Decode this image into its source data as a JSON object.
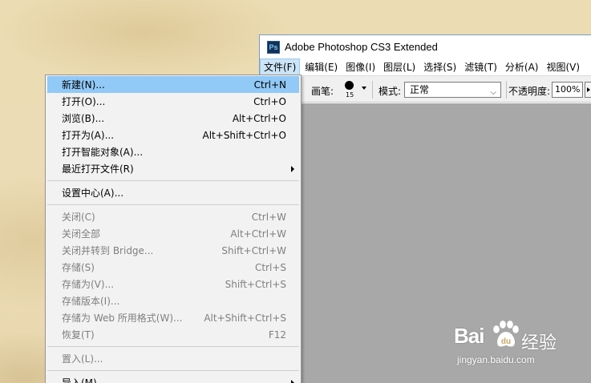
{
  "window": {
    "logo_text": "Ps",
    "title": "Adobe Photoshop CS3 Extended"
  },
  "menubar": {
    "items": [
      {
        "label": "文件(F)"
      },
      {
        "label": "编辑(E)"
      },
      {
        "label": "图像(I)"
      },
      {
        "label": "图层(L)"
      },
      {
        "label": "选择(S)"
      },
      {
        "label": "滤镜(T)"
      },
      {
        "label": "分析(A)"
      },
      {
        "label": "视图(V)"
      }
    ]
  },
  "options_bar": {
    "brush_label": "画笔:",
    "brush_size": "15",
    "mode_label": "模式:",
    "mode_value": "正常",
    "opacity_label": "不透明度:",
    "opacity_value": "100%"
  },
  "file_menu": {
    "items": [
      {
        "label": "新建(N)...",
        "shortcut": "Ctrl+N"
      },
      {
        "label": "打开(O)...",
        "shortcut": "Ctrl+O"
      },
      {
        "label": "浏览(B)...",
        "shortcut": "Alt+Ctrl+O"
      },
      {
        "label": "打开为(A)...",
        "shortcut": "Alt+Shift+Ctrl+O"
      },
      {
        "label": "打开智能对象(A)...",
        "shortcut": ""
      },
      {
        "label": "最近打开文件(R)",
        "shortcut": ""
      },
      {
        "label": "设置中心(A)...",
        "shortcut": ""
      },
      {
        "label": "关闭(C)",
        "shortcut": "Ctrl+W"
      },
      {
        "label": "关闭全部",
        "shortcut": "Alt+Ctrl+W"
      },
      {
        "label": "关闭并转到 Bridge...",
        "shortcut": "Shift+Ctrl+W"
      },
      {
        "label": "存储(S)",
        "shortcut": "Ctrl+S"
      },
      {
        "label": "存储为(V)...",
        "shortcut": "Shift+Ctrl+S"
      },
      {
        "label": "存储版本(I)...",
        "shortcut": ""
      },
      {
        "label": "存储为 Web 所用格式(W)...",
        "shortcut": "Alt+Shift+Ctrl+S"
      },
      {
        "label": "恢复(T)",
        "shortcut": "F12"
      },
      {
        "label": "置入(L)...",
        "shortcut": ""
      },
      {
        "label": "导入(M)",
        "shortcut": ""
      }
    ]
  },
  "watermark": {
    "brand": "Bai",
    "brand_suffix": "du",
    "name_cn": "经验",
    "url": "jingyan.baidu.com"
  },
  "colors": {
    "highlight": "#91c9f7",
    "workspace": "#a8a8a8",
    "background": "#ecdcb3"
  }
}
